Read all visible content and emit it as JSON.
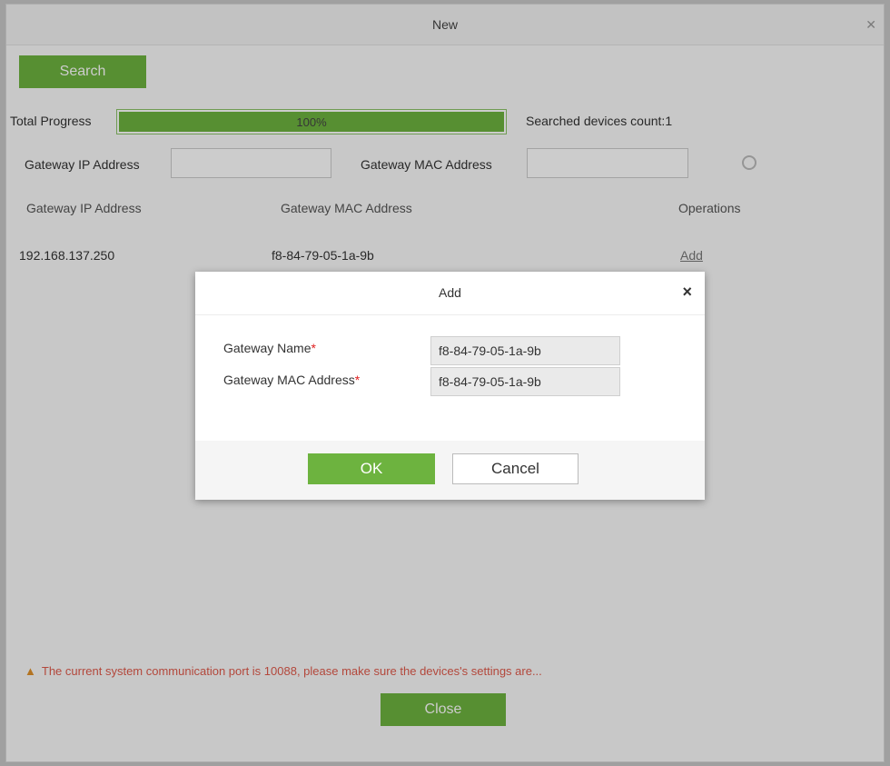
{
  "background_window": {
    "title": "New",
    "search_label": "Search",
    "progress_label": "Total Progress",
    "progress_text": "100%",
    "progress_fraction": 1.0,
    "devices_count_text": "Searched devices count:1",
    "filter": {
      "ip_label": "Gateway IP Address",
      "mac_label": "Gateway MAC Address"
    },
    "table": {
      "columns": [
        "Gateway IP Address",
        "Gateway MAC Address",
        "Operations"
      ],
      "rows": [
        {
          "ip": "192.168.137.250",
          "mac": "f8-84-79-05-1a-9b",
          "operation": "Add"
        }
      ]
    },
    "warning": "The current system communication port is 10088, please make sure the devices's settings are...",
    "close_label": "Close"
  },
  "modal": {
    "title": "Add",
    "fields": [
      {
        "label": "Gateway Name",
        "value": "f8-84-79-05-1a-9b",
        "required": "*"
      },
      {
        "label": "Gateway MAC Address",
        "value": "f8-84-79-05-1a-9b",
        "required": "*"
      }
    ],
    "ok_label": "OK",
    "cancel_label": "Cancel",
    "close_glyph": "×"
  },
  "colors": {
    "accent": "#6db33f",
    "required": "#e02020",
    "warning": "#e05a4b"
  }
}
